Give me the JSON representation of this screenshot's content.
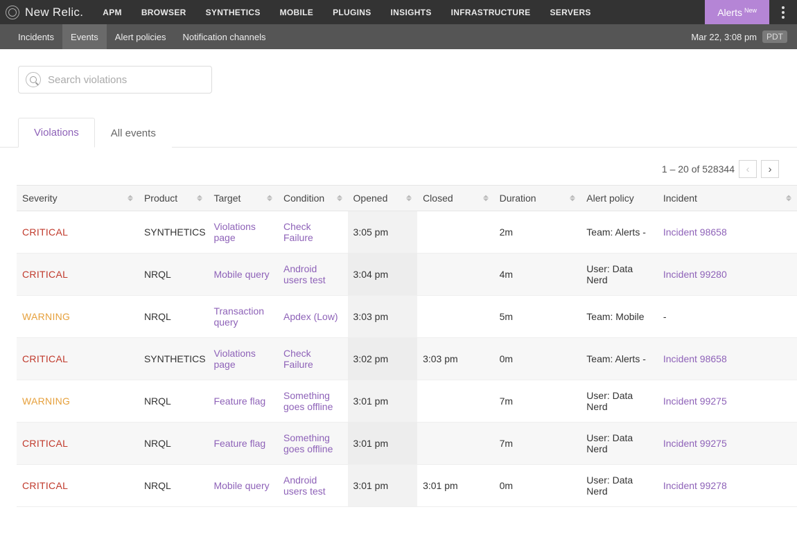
{
  "brand": "New Relic.",
  "topnav": [
    "APM",
    "BROWSER",
    "SYNTHETICS",
    "MOBILE",
    "PLUGINS",
    "INSIGHTS",
    "INFRASTRUCTURE",
    "SERVERS"
  ],
  "alerts_button": {
    "label": "Alerts",
    "badge": "New"
  },
  "subnav": {
    "items": [
      "Incidents",
      "Events",
      "Alert policies",
      "Notification channels"
    ],
    "active_index": 1,
    "timestamp": "Mar 22, 3:08 pm",
    "timezone": "PDT"
  },
  "search": {
    "placeholder": "Search violations",
    "value": ""
  },
  "tabs": {
    "items": [
      "Violations",
      "All events"
    ],
    "active_index": 0
  },
  "pagination": {
    "range_start": 1,
    "range_end": 20,
    "total": 528344,
    "text": "1 – 20 of 528344"
  },
  "columns": [
    "Severity",
    "Product",
    "Target",
    "Condition",
    "Opened",
    "Closed",
    "Duration",
    "Alert policy",
    "Incident"
  ],
  "rows": [
    {
      "severity": "CRITICAL",
      "product": "SYNTHETICS",
      "target": "Violations page",
      "condition": "Check Failure",
      "opened": "3:05 pm",
      "closed": "",
      "duration": "2m",
      "policy": "Team: Alerts -",
      "incident": "Incident 98658"
    },
    {
      "severity": "CRITICAL",
      "product": "NRQL",
      "target": "Mobile query",
      "condition": "Android users test",
      "opened": "3:04 pm",
      "closed": "",
      "duration": "4m",
      "policy": "User: Data Nerd",
      "incident": "Incident 99280"
    },
    {
      "severity": "WARNING",
      "product": "NRQL",
      "target": "Transaction query",
      "condition": "Apdex (Low)",
      "opened": "3:03 pm",
      "closed": "",
      "duration": "5m",
      "policy": "Team: Mobile",
      "incident": "-"
    },
    {
      "severity": "CRITICAL",
      "product": "SYNTHETICS",
      "target": "Violations page",
      "condition": "Check Failure",
      "opened": "3:02 pm",
      "closed": "3:03 pm",
      "duration": "0m",
      "policy": "Team: Alerts -",
      "incident": "Incident 98658"
    },
    {
      "severity": "WARNING",
      "product": "NRQL",
      "target": "Feature flag",
      "condition": "Something goes offline",
      "opened": "3:01 pm",
      "closed": "",
      "duration": "7m",
      "policy": "User: Data Nerd",
      "incident": "Incident 99275"
    },
    {
      "severity": "CRITICAL",
      "product": "NRQL",
      "target": "Feature flag",
      "condition": "Something goes offline",
      "opened": "3:01 pm",
      "closed": "",
      "duration": "7m",
      "policy": "User: Data Nerd",
      "incident": "Incident 99275"
    },
    {
      "severity": "CRITICAL",
      "product": "NRQL",
      "target": "Mobile query",
      "condition": "Android users test",
      "opened": "3:01 pm",
      "closed": "3:01 pm",
      "duration": "0m",
      "policy": "User: Data Nerd",
      "incident": "Incident 99278"
    }
  ]
}
